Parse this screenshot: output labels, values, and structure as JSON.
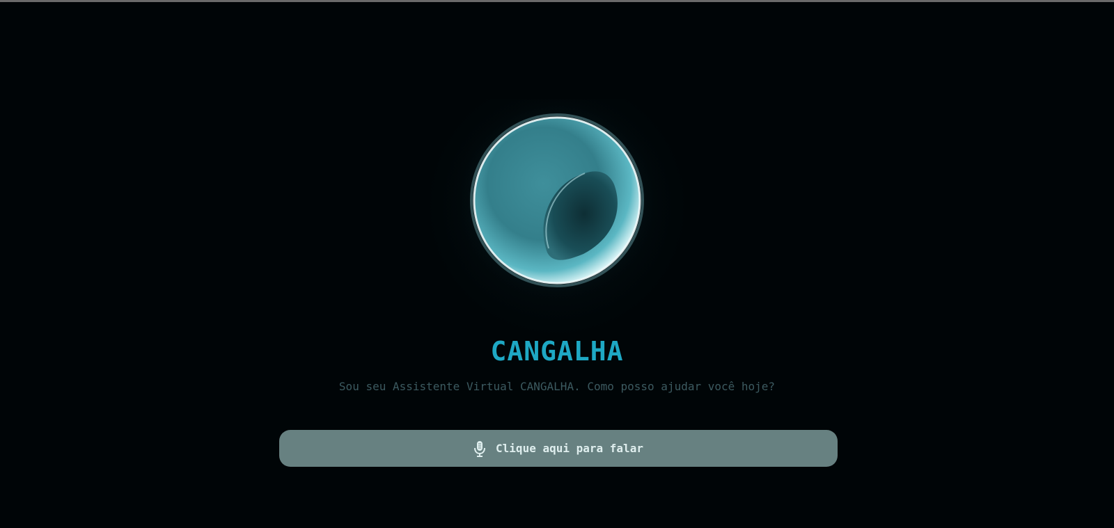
{
  "assistant": {
    "name": "CANGALHA",
    "greeting": "Sou seu Assistente Virtual CANGALHA. Como posso ajudar você hoje?"
  },
  "orb": {
    "icon": "glowing-sphere-icon",
    "accent_color": "#5fc3d1"
  },
  "talk_button": {
    "label": "Clique aqui para falar",
    "icon": "microphone-icon",
    "background": "#678181"
  },
  "colors": {
    "background": "#000507",
    "title": "#1ea8c4",
    "subtitle": "#3c5a60"
  }
}
